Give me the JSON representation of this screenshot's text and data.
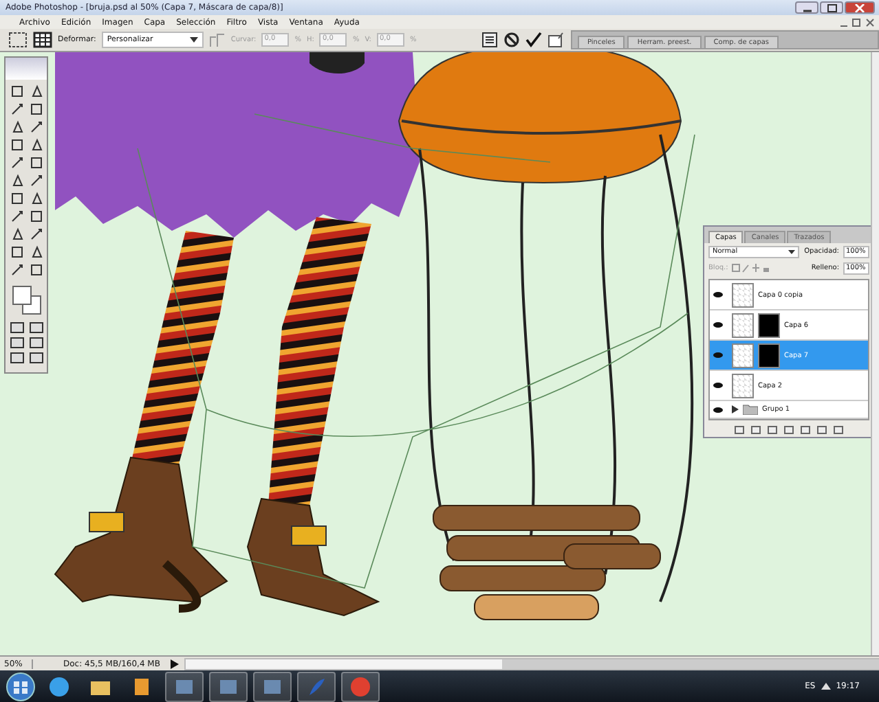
{
  "window": {
    "title": "Adobe Photoshop - [bruja.psd al 50% (Capa 7, Máscara de capa/8)]"
  },
  "menu": [
    "Archivo",
    "Edición",
    "Imagen",
    "Capa",
    "Selección",
    "Filtro",
    "Vista",
    "Ventana",
    "Ayuda"
  ],
  "options_bar": {
    "warp_label": "Deformar:",
    "warp_style": "Personalizar",
    "fields": [
      {
        "label": "Curvar:",
        "value": "0,0",
        "unit": "%"
      },
      {
        "label": "H:",
        "value": "0,0",
        "unit": "%"
      },
      {
        "label": "V:",
        "value": "0,0",
        "unit": "%"
      }
    ]
  },
  "dock_tabs": [
    "Pinceles",
    "Herram. preest.",
    "Comp. de capas"
  ],
  "layers_panel": {
    "tabs": [
      {
        "label": "Capas",
        "selected": true
      },
      {
        "label": "Canales",
        "selected": false
      },
      {
        "label": "Trazados",
        "selected": false
      }
    ],
    "blend_mode": "Normal",
    "opacity_label": "Opacidad:",
    "opacity": "100%",
    "lock_label": "Bloq.:",
    "fill_label": "Relleno:",
    "fill": "100%",
    "layers": [
      {
        "name": "Capa 0 copia",
        "kind": "layer",
        "visible": true,
        "selected": false,
        "has_mask": false
      },
      {
        "name": "Capa 6",
        "kind": "layer",
        "visible": true,
        "selected": false,
        "has_mask": true
      },
      {
        "name": "Capa 7",
        "kind": "layer",
        "visible": true,
        "selected": true,
        "has_mask": true
      },
      {
        "name": "Capa 2",
        "kind": "layer",
        "visible": true,
        "selected": false,
        "has_mask": false
      },
      {
        "name": "Grupo 1",
        "kind": "group",
        "visible": true,
        "selected": false,
        "has_mask": false
      }
    ]
  },
  "status_bar": {
    "zoom": "50%",
    "doc": "Doc: 45,5 MB/160,4 MB"
  },
  "taskbar": {
    "language": "ES",
    "clock": "19:17"
  }
}
